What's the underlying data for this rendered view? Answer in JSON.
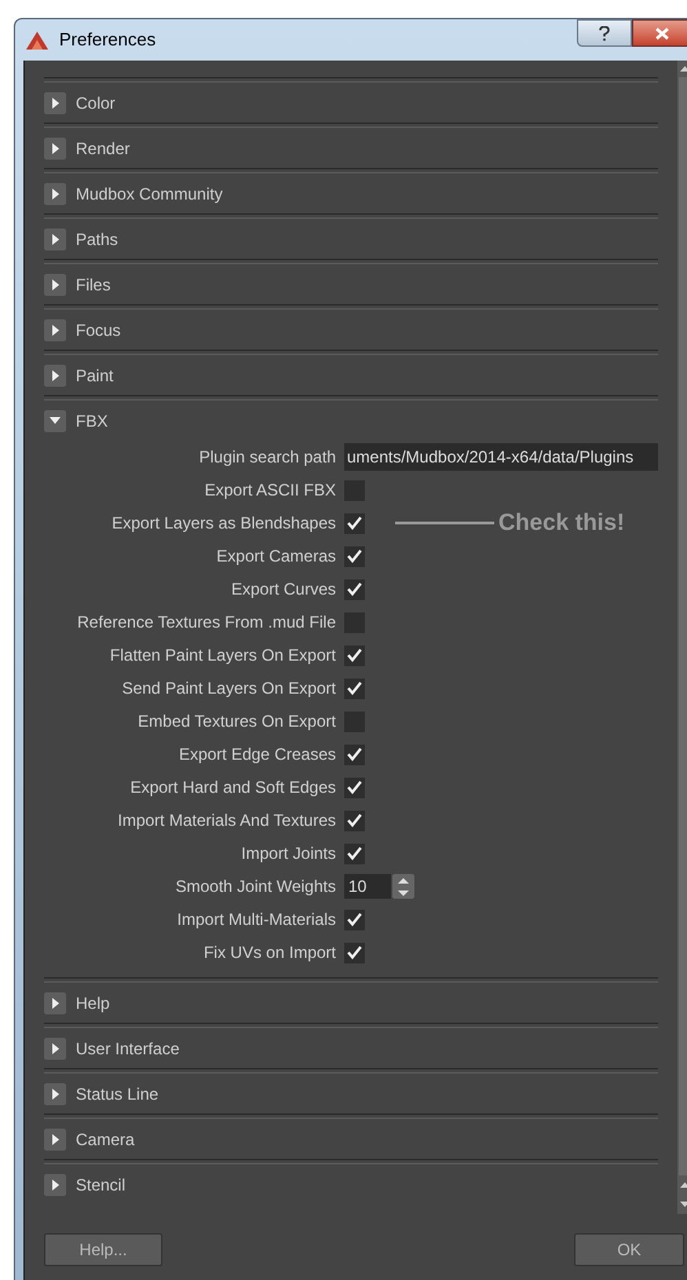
{
  "window": {
    "title": "Preferences"
  },
  "sections": [
    {
      "title": "Color",
      "expanded": false
    },
    {
      "title": "Render",
      "expanded": false
    },
    {
      "title": "Mudbox Community",
      "expanded": false
    },
    {
      "title": "Paths",
      "expanded": false
    },
    {
      "title": "Files",
      "expanded": false
    },
    {
      "title": "Focus",
      "expanded": false
    },
    {
      "title": "Paint",
      "expanded": false
    },
    {
      "title": "FBX",
      "expanded": true,
      "options": [
        {
          "label": "Plugin search path",
          "kind": "text",
          "value": "uments/Mudbox/2014-x64/data/Plugins"
        },
        {
          "label": "Export ASCII FBX",
          "kind": "checkbox",
          "checked": false
        },
        {
          "label": "Export Layers as Blendshapes",
          "kind": "checkbox",
          "checked": true,
          "annotation": "Check this!"
        },
        {
          "label": "Export Cameras",
          "kind": "checkbox",
          "checked": true
        },
        {
          "label": "Export Curves",
          "kind": "checkbox",
          "checked": true
        },
        {
          "label": "Reference Textures From .mud File",
          "kind": "checkbox",
          "checked": false
        },
        {
          "label": "Flatten Paint Layers On Export",
          "kind": "checkbox",
          "checked": true
        },
        {
          "label": "Send Paint Layers On Export",
          "kind": "checkbox",
          "checked": true
        },
        {
          "label": "Embed Textures On Export",
          "kind": "checkbox",
          "checked": false
        },
        {
          "label": "Export Edge Creases",
          "kind": "checkbox",
          "checked": true
        },
        {
          "label": "Export Hard and Soft Edges",
          "kind": "checkbox",
          "checked": true
        },
        {
          "label": "Import Materials And Textures",
          "kind": "checkbox",
          "checked": true
        },
        {
          "label": "Import Joints",
          "kind": "checkbox",
          "checked": true
        },
        {
          "label": "Smooth Joint Weights",
          "kind": "spin",
          "value": "10"
        },
        {
          "label": "Import Multi-Materials",
          "kind": "checkbox",
          "checked": true
        },
        {
          "label": "Fix UVs on Import",
          "kind": "checkbox",
          "checked": true
        }
      ]
    },
    {
      "title": "Help",
      "expanded": false
    },
    {
      "title": "User Interface",
      "expanded": false
    },
    {
      "title": "Status Line",
      "expanded": false
    },
    {
      "title": "Camera",
      "expanded": false
    },
    {
      "title": "Stencil",
      "expanded": false
    }
  ],
  "buttons": [
    "Help...",
    "OK"
  ]
}
